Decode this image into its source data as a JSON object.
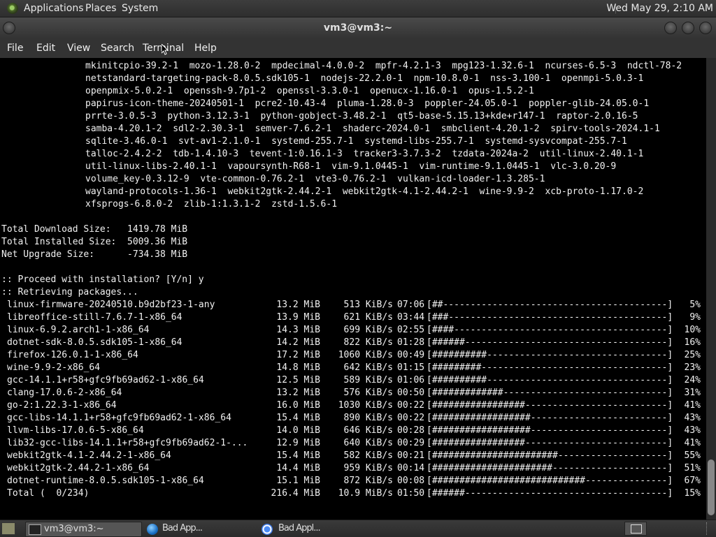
{
  "top_panel": {
    "applications": "Applications",
    "places": "Places",
    "system": "System",
    "clock": "Wed May 29,  2:10 AM"
  },
  "window": {
    "title": "vm3@vm3:~",
    "menu": [
      "File",
      "Edit",
      "View",
      "Search",
      "Terminal",
      "Help"
    ]
  },
  "terminal": {
    "packages": [
      "mkinitcpio-39.2-1  mozo-1.28.0-2  mpdecimal-4.0.0-2  mpfr-4.2.1-3  mpg123-1.32.6-1  ncurses-6.5-3  ndctl-78-2",
      "netstandard-targeting-pack-8.0.5.sdk105-1  nodejs-22.2.0-1  npm-10.8.0-1  nss-3.100-1  openmpi-5.0.3-1",
      "openpmix-5.0.2-1  openssh-9.7p1-2  openssl-3.3.0-1  openucx-1.16.0-1  opus-1.5.2-1",
      "papirus-icon-theme-20240501-1  pcre2-10.43-4  pluma-1.28.0-3  poppler-24.05.0-1  poppler-glib-24.05.0-1",
      "prrte-3.0.5-3  python-3.12.3-1  python-gobject-3.48.2-1  qt5-base-5.15.13+kde+r147-1  raptor-2.0.16-5",
      "samba-4.20.1-2  sdl2-2.30.3-1  semver-7.6.2-1  shaderc-2024.0-1  smbclient-4.20.1-2  spirv-tools-2024.1-1",
      "sqlite-3.46.0-1  svt-av1-2.1.0-1  systemd-255.7-1  systemd-libs-255.7-1  systemd-sysvcompat-255.7-1",
      "talloc-2.4.2-2  tdb-1.4.10-3  tevent-1:0.16.1-3  tracker3-3.7.3-2  tzdata-2024a-2  util-linux-2.40.1-1",
      "util-linux-libs-2.40.1-1  vapoursynth-R68-1  vim-9.1.0445-1  vim-runtime-9.1.0445-1  vlc-3.0.20-9",
      "volume_key-0.3.12-9  vte-common-0.76.2-1  vte3-0.76.2-1  vulkan-icd-loader-1.3.285-1",
      "wayland-protocols-1.36-1  webkit2gtk-2.44.2-1  webkit2gtk-4.1-2.44.2-1  wine-9.9-2  xcb-proto-1.17.0-2",
      "xfsprogs-6.8.0-2  zlib-1:1.3.1-2  zstd-1.5.6-1"
    ],
    "summary": [
      "Total Download Size:   1419.78 MiB",
      "Total Installed Size:  5009.36 MiB",
      "Net Upgrade Size:      -734.38 MiB"
    ],
    "prompt_line": ":: Proceed with installation? [Y/n] y",
    "retrieving_line": ":: Retrieving packages...",
    "downloads": [
      {
        "name": "linux-firmware-20240510.b9d2bf23-1-any",
        "size": "13.2 MiB",
        "rate": "513 KiB/s",
        "eta": "07:06",
        "bar": "[##-----------------------------------------]",
        "pct": "5%"
      },
      {
        "name": "libreoffice-still-7.6.7-1-x86_64",
        "size": "13.9 MiB",
        "rate": "621 KiB/s",
        "eta": "03:44",
        "bar": "[###----------------------------------------]",
        "pct": "9%"
      },
      {
        "name": "linux-6.9.2.arch1-1-x86_64",
        "size": "14.3 MiB",
        "rate": "699 KiB/s",
        "eta": "02:55",
        "bar": "[####---------------------------------------]",
        "pct": "10%"
      },
      {
        "name": "dotnet-sdk-8.0.5.sdk105-1-x86_64",
        "size": "14.2 MiB",
        "rate": "822 KiB/s",
        "eta": "01:28",
        "bar": "[######-------------------------------------]",
        "pct": "16%"
      },
      {
        "name": "firefox-126.0.1-1-x86_64",
        "size": "17.2 MiB",
        "rate": "1060 KiB/s",
        "eta": "00:49",
        "bar": "[##########---------------------------------]",
        "pct": "25%"
      },
      {
        "name": "wine-9.9-2-x86_64",
        "size": "14.8 MiB",
        "rate": "642 KiB/s",
        "eta": "01:15",
        "bar": "[#########----------------------------------]",
        "pct": "23%"
      },
      {
        "name": "gcc-14.1.1+r58+gfc9fb69ad62-1-x86_64",
        "size": "12.5 MiB",
        "rate": "589 KiB/s",
        "eta": "01:06",
        "bar": "[##########---------------------------------]",
        "pct": "24%"
      },
      {
        "name": "clang-17.0.6-2-x86_64",
        "size": "13.2 MiB",
        "rate": "576 KiB/s",
        "eta": "00:50",
        "bar": "[#############------------------------------]",
        "pct": "31%"
      },
      {
        "name": "go-2:1.22.3-1-x86_64",
        "size": "16.0 MiB",
        "rate": "1030 KiB/s",
        "eta": "00:22",
        "bar": "[#################--------------------------]",
        "pct": "41%"
      },
      {
        "name": "gcc-libs-14.1.1+r58+gfc9fb69ad62-1-x86_64",
        "size": "15.4 MiB",
        "rate": "890 KiB/s",
        "eta": "00:22",
        "bar": "[##################-------------------------]",
        "pct": "43%"
      },
      {
        "name": "llvm-libs-17.0.6-5-x86_64",
        "size": "14.0 MiB",
        "rate": "646 KiB/s",
        "eta": "00:28",
        "bar": "[##################-------------------------]",
        "pct": "43%"
      },
      {
        "name": "lib32-gcc-libs-14.1.1+r58+gfc9fb69ad62-1-...",
        "size": "12.9 MiB",
        "rate": "640 KiB/s",
        "eta": "00:29",
        "bar": "[#################--------------------------]",
        "pct": "41%"
      },
      {
        "name": "webkit2gtk-4.1-2.44.2-1-x86_64",
        "size": "15.4 MiB",
        "rate": "582 KiB/s",
        "eta": "00:21",
        "bar": "[#######################--------------------]",
        "pct": "55%"
      },
      {
        "name": "webkit2gtk-2.44.2-1-x86_64",
        "size": "14.4 MiB",
        "rate": "959 KiB/s",
        "eta": "00:14",
        "bar": "[######################---------------------]",
        "pct": "51%"
      },
      {
        "name": "dotnet-runtime-8.0.5.sdk105-1-x86_64",
        "size": "15.1 MiB",
        "rate": "872 KiB/s",
        "eta": "00:08",
        "bar": "[############################---------------]",
        "pct": "67%"
      },
      {
        "name": "Total (  0/234)",
        "size": "216.4 MiB",
        "rate": "10.9 MiB/s",
        "eta": "01:50",
        "bar": "[######-------------------------------------]",
        "pct": "15%"
      }
    ]
  },
  "taskbar": {
    "terminal_task": "vm3@vm3:~",
    "browser_task_1": "Bad App...",
    "browser_task_2": "Bad Appl..."
  },
  "colors": {
    "terminal_bg": "#000000",
    "terminal_fg": "#f2f2f2",
    "panel": "#333333"
  },
  "icons": [
    "distro-logo-icon",
    "window-menu-icon",
    "minimize-icon",
    "maximize-icon",
    "close-icon",
    "terminal-icon",
    "globe-icon",
    "chromium-icon",
    "show-desktop-icon",
    "tray-icon"
  ]
}
